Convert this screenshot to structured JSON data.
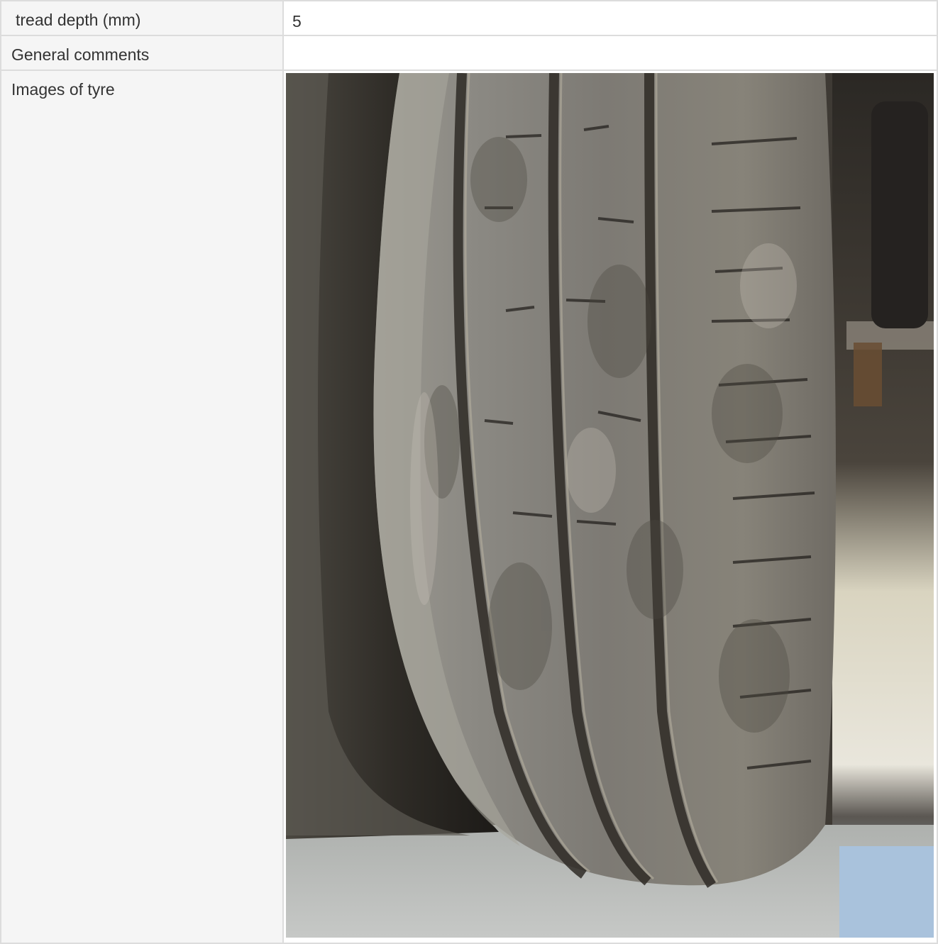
{
  "rows": [
    {
      "label": "tread depth (mm)",
      "value": "5"
    },
    {
      "label": "General comments",
      "value": ""
    },
    {
      "label": "Images of tyre"
    }
  ],
  "tyre_image": {
    "alt": "Images of tyre"
  }
}
